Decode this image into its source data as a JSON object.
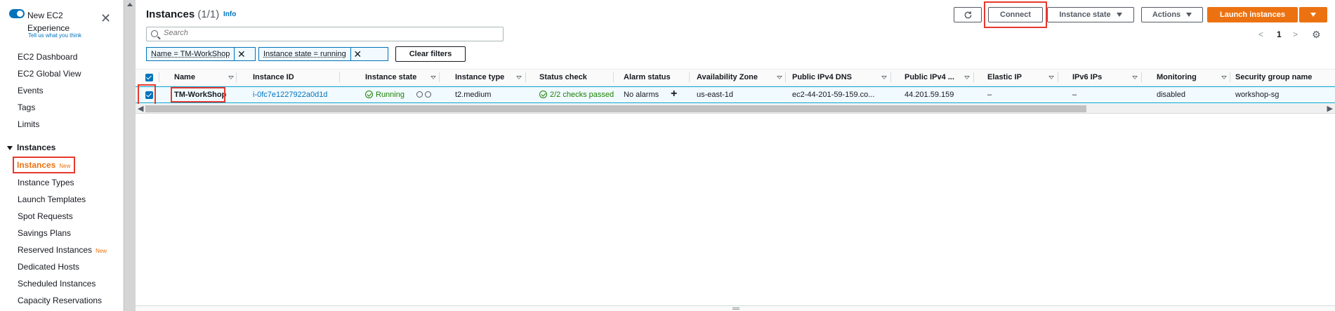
{
  "sidebar": {
    "toggle_label": "New EC2 Experience",
    "feedback": "Tell us what you think",
    "links": {
      "ec2_dashboard": "EC2 Dashboard",
      "global_view": "EC2 Global View",
      "events": "Events",
      "tags": "Tags",
      "limits": "Limits"
    },
    "section": "Instances",
    "active_item": {
      "label": "Instances",
      "badge": "New"
    },
    "items": {
      "instance_types": "Instance Types",
      "launch_templates": "Launch Templates",
      "spot_requests": "Spot Requests",
      "savings_plans": "Savings Plans",
      "reserved_instances": "Reserved Instances",
      "reserved_badge": "New",
      "dedicated_hosts": "Dedicated Hosts",
      "scheduled_instances": "Scheduled Instances",
      "capacity_reservations": "Capacity Reservations"
    }
  },
  "header": {
    "title": "Instances",
    "count": "(1/1)",
    "info": "Info"
  },
  "toolbar": {
    "connect": "Connect",
    "instance_state": "Instance state",
    "actions": "Actions",
    "launch": "Launch instances"
  },
  "search": {
    "placeholder": "Search"
  },
  "pagination": {
    "page": "1",
    "prev": "<",
    "next": ">"
  },
  "filters": {
    "name": "Name = TM-WorkShop",
    "state": "Instance state = running",
    "clear": "Clear filters"
  },
  "table": {
    "columns": {
      "name": "Name",
      "instance_id": "Instance ID",
      "instance_state": "Instance state",
      "instance_type": "Instance type",
      "status_check": "Status check",
      "alarm_status": "Alarm status",
      "az": "Availability Zone",
      "dns": "Public IPv4 DNS",
      "ipv4": "Public IPv4 ...",
      "elastic_ip": "Elastic IP",
      "ipv6": "IPv6 IPs",
      "monitoring": "Monitoring",
      "sg": "Security group name"
    },
    "row": {
      "name": "TM-WorkShop",
      "instance_id": "i-0fc7e1227922a0d1d",
      "instance_state": "Running",
      "instance_type": "t2.medium",
      "status_check": "2/2 checks passed",
      "alarm_status": "No alarms",
      "alarm_add": "+",
      "az": "us-east-1d",
      "dns": "ec2-44-201-59-159.co...",
      "ipv4": "44.201.59.159",
      "elastic_ip": "–",
      "ipv6": "–",
      "monitoring": "disabled",
      "sg": "workshop-sg"
    }
  },
  "colors": {
    "accent": "#0073bb",
    "primary_button": "#ec7211",
    "highlight": "#e7392f",
    "success": "#1d8102"
  },
  "icons": {
    "close": "close-icon",
    "refresh": "refresh-icon",
    "settings": "gear-icon",
    "search": "search-icon"
  }
}
